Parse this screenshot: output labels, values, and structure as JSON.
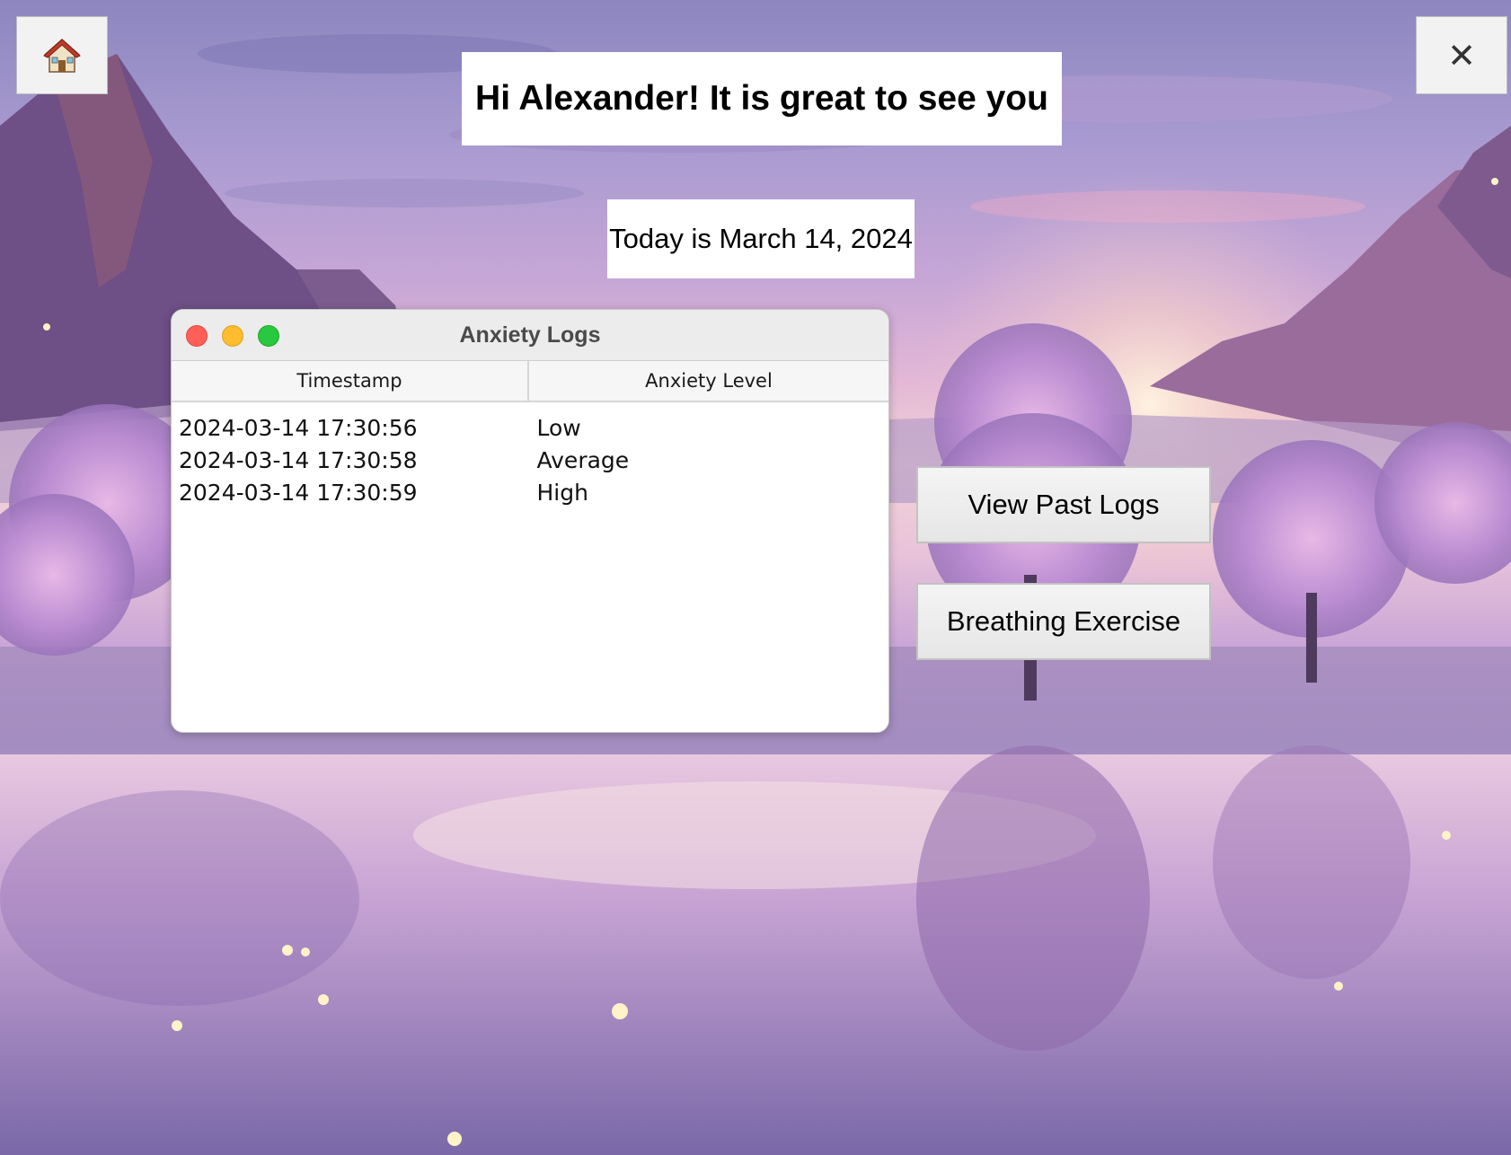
{
  "header": {
    "home_icon": "house-icon",
    "close_label": "✕",
    "greeting": "Hi Alexander! It is great to see you",
    "date_text": "Today is March 14, 2024"
  },
  "log_window": {
    "title": "Anxiety Logs",
    "columns": [
      "Timestamp",
      "Anxiety Level"
    ],
    "rows": [
      {
        "timestamp": "2024-03-14 17:30:56",
        "level": "Low"
      },
      {
        "timestamp": "2024-03-14 17:30:58",
        "level": "Average"
      },
      {
        "timestamp": "2024-03-14 17:30:59",
        "level": "High"
      }
    ]
  },
  "actions": {
    "view_past_logs": "View Past Logs",
    "breathing_exercise": "Breathing Exercise"
  },
  "colors": {
    "traffic_red": "#ff5f57",
    "traffic_yellow": "#febc2e",
    "traffic_green": "#28c840"
  }
}
